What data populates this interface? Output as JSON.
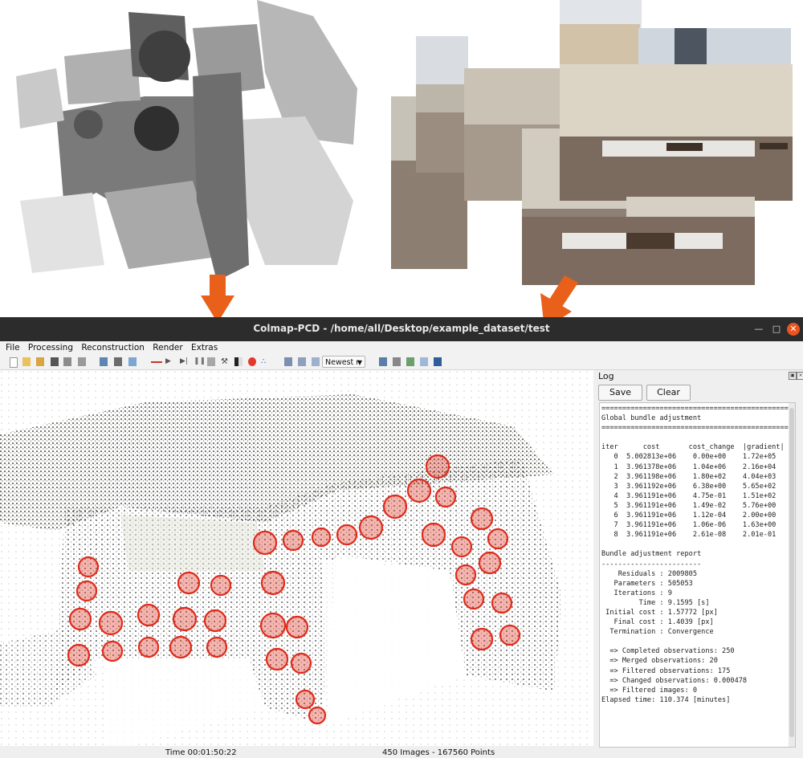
{
  "window": {
    "title": "Colmap-PCD - /home/all/Desktop/example_dataset/test"
  },
  "menu": [
    "File",
    "Processing",
    "Reconstruction",
    "Render",
    "Extras"
  ],
  "toolbar": {
    "sort_select": "Newest r"
  },
  "log": {
    "title": "Log",
    "save_label": "Save",
    "clear_label": "Clear",
    "lines": [
      "==============================================",
      "Global bundle adjustment",
      "==============================================",
      "",
      "iter      cost       cost_change  |gradient|",
      "   0  5.002813e+06    0.00e+00    1.72e+05",
      "   1  3.961378e+06    1.04e+06    2.16e+04",
      "   2  3.961198e+06    1.80e+02    4.04e+03",
      "   3  3.961192e+06    6.38e+00    5.65e+02",
      "   4  3.961191e+06    4.75e-01    1.51e+02",
      "   5  3.961191e+06    1.49e-02    5.76e+00",
      "   6  3.961191e+06    1.12e-04    2.00e+00",
      "   7  3.961191e+06    1.06e-06    1.63e+00",
      "   8  3.961191e+06    2.61e-08    2.01e-01",
      "",
      "Bundle adjustment report",
      "------------------------",
      "    Residuals : 2009805",
      "   Parameters : 505053",
      "   Iterations : 9",
      "         Time : 9.1595 [s]",
      " Initial cost : 1.57772 [px]",
      "   Final cost : 1.4039 [px]",
      "  Termination : Convergence",
      "",
      "  => Completed observations: 250",
      "  => Merged observations: 20",
      "  => Filtered observations: 175",
      "  => Changed observations: 0.000478",
      "  => Filtered images: 0",
      "Elapsed time: 110.374 [minutes]"
    ]
  },
  "status": {
    "time": "Time 00:01:50:22",
    "counts": "450 Images - 167560 Points"
  },
  "colors": {
    "arrow": "#e8601a",
    "camera": "#e02a1a",
    "titlebar": "#2c2c2c",
    "close_button": "#e95420"
  },
  "icons": [
    "new-project-icon",
    "open-project-icon",
    "folder-icon",
    "save-icon",
    "import-icon",
    "export-icon",
    "images-icon",
    "grid-icon",
    "models-icon",
    "feature-icon",
    "play-icon",
    "step-icon",
    "pause-icon",
    "database-icon",
    "wrench-icon",
    "contrast-icon",
    "record-icon",
    "cluster-icon",
    "zoom-in-icon",
    "zoom-out-icon",
    "scale-icon",
    "list-icon",
    "matrix-icon",
    "chart-icon",
    "image-view-icon",
    "save-disk-icon"
  ]
}
